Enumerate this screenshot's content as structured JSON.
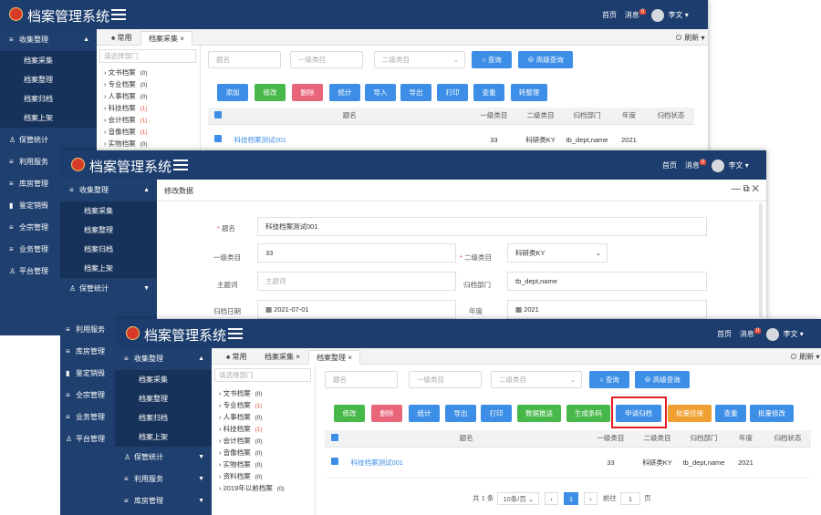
{
  "app": {
    "title": "档案管理系统"
  },
  "header": {
    "home": "首页",
    "messages": "消息",
    "message_count": "0",
    "user": "李文",
    "user_caret": "▾"
  },
  "sidebar": {
    "collect": "收集整理",
    "sub": [
      "档案采集",
      "档案整理",
      "档案归档",
      "档案上架"
    ],
    "items": [
      "保管统计",
      "利用服务",
      "库房管理",
      "鉴定销毁",
      "全宗管理",
      "业务管理",
      "平台管理"
    ]
  },
  "tabs": {
    "common": "常用",
    "collect": "档案采集",
    "arrange": "档案整理",
    "refresh": "刷新"
  },
  "tree": {
    "search_placeholder": "请选择部门",
    "items": [
      {
        "label": "文书档案",
        "count": "(0)"
      },
      {
        "label": "专业档案",
        "count": "(0)"
      },
      {
        "label": "人事档案",
        "count": "(0)"
      },
      {
        "label": "科技档案",
        "count": "(1)"
      },
      {
        "label": "会计档案",
        "count": "(1)"
      },
      {
        "label": "音像档案",
        "count": "(1)"
      },
      {
        "label": "实物档案",
        "count": "(0)"
      }
    ],
    "items3": [
      {
        "label": "文书档案",
        "count": "(0)"
      },
      {
        "label": "专业档案",
        "count": "(1)"
      },
      {
        "label": "人事档案",
        "count": "(0)"
      },
      {
        "label": "科技档案",
        "count": "(1)"
      },
      {
        "label": "会计档案",
        "count": "(0)"
      },
      {
        "label": "音像档案",
        "count": "(0)"
      },
      {
        "label": "实物档案",
        "count": "(0)"
      },
      {
        "label": "资料档案",
        "count": "(0)"
      },
      {
        "label": "2019年以前档案",
        "count": "(0)"
      }
    ]
  },
  "filters": {
    "title_ph": "题名",
    "cat1_ph": "一级类目",
    "cat2_ph": "二级类目",
    "search": "查询",
    "adv_search": "高级查询"
  },
  "toolbar1": [
    "添加",
    "修改",
    "删除",
    "统计",
    "导入",
    "导出",
    "打印",
    "查重",
    "转整理"
  ],
  "toolbar3": [
    "修改",
    "删除",
    "统计",
    "导出",
    "打印",
    "数据推送",
    "生成条码",
    "申请归档",
    "批量挂接",
    "查重",
    "批量修改"
  ],
  "table": {
    "headers": [
      "题名",
      "一级类目",
      "二级类目",
      "归档部门",
      "年度",
      "归档状态"
    ],
    "row": {
      "title": "科技档案测试001",
      "cat1": "33",
      "cat2": "科研类KY",
      "dept": "tb_dept,name",
      "year": "2021",
      "status": ""
    }
  },
  "dialog": {
    "title": "修改数据",
    "labels": {
      "name": "题名",
      "cat1": "一级类目",
      "cat2": "二级类目",
      "subject": "主题词",
      "dept": "归档部门",
      "date": "归档日期",
      "year": "年度"
    },
    "values": {
      "name": "科技档案测试001",
      "cat1": "33",
      "cat2": "科研类KY",
      "subject_ph": "主题词",
      "dept": "tb_dept,name",
      "date": "2021-07-01",
      "year": "2021"
    }
  },
  "pager": {
    "total": "共 1 条",
    "size": "10条/页",
    "page": "1",
    "goto": "前往",
    "goto_val": "1",
    "page_unit": "页"
  }
}
